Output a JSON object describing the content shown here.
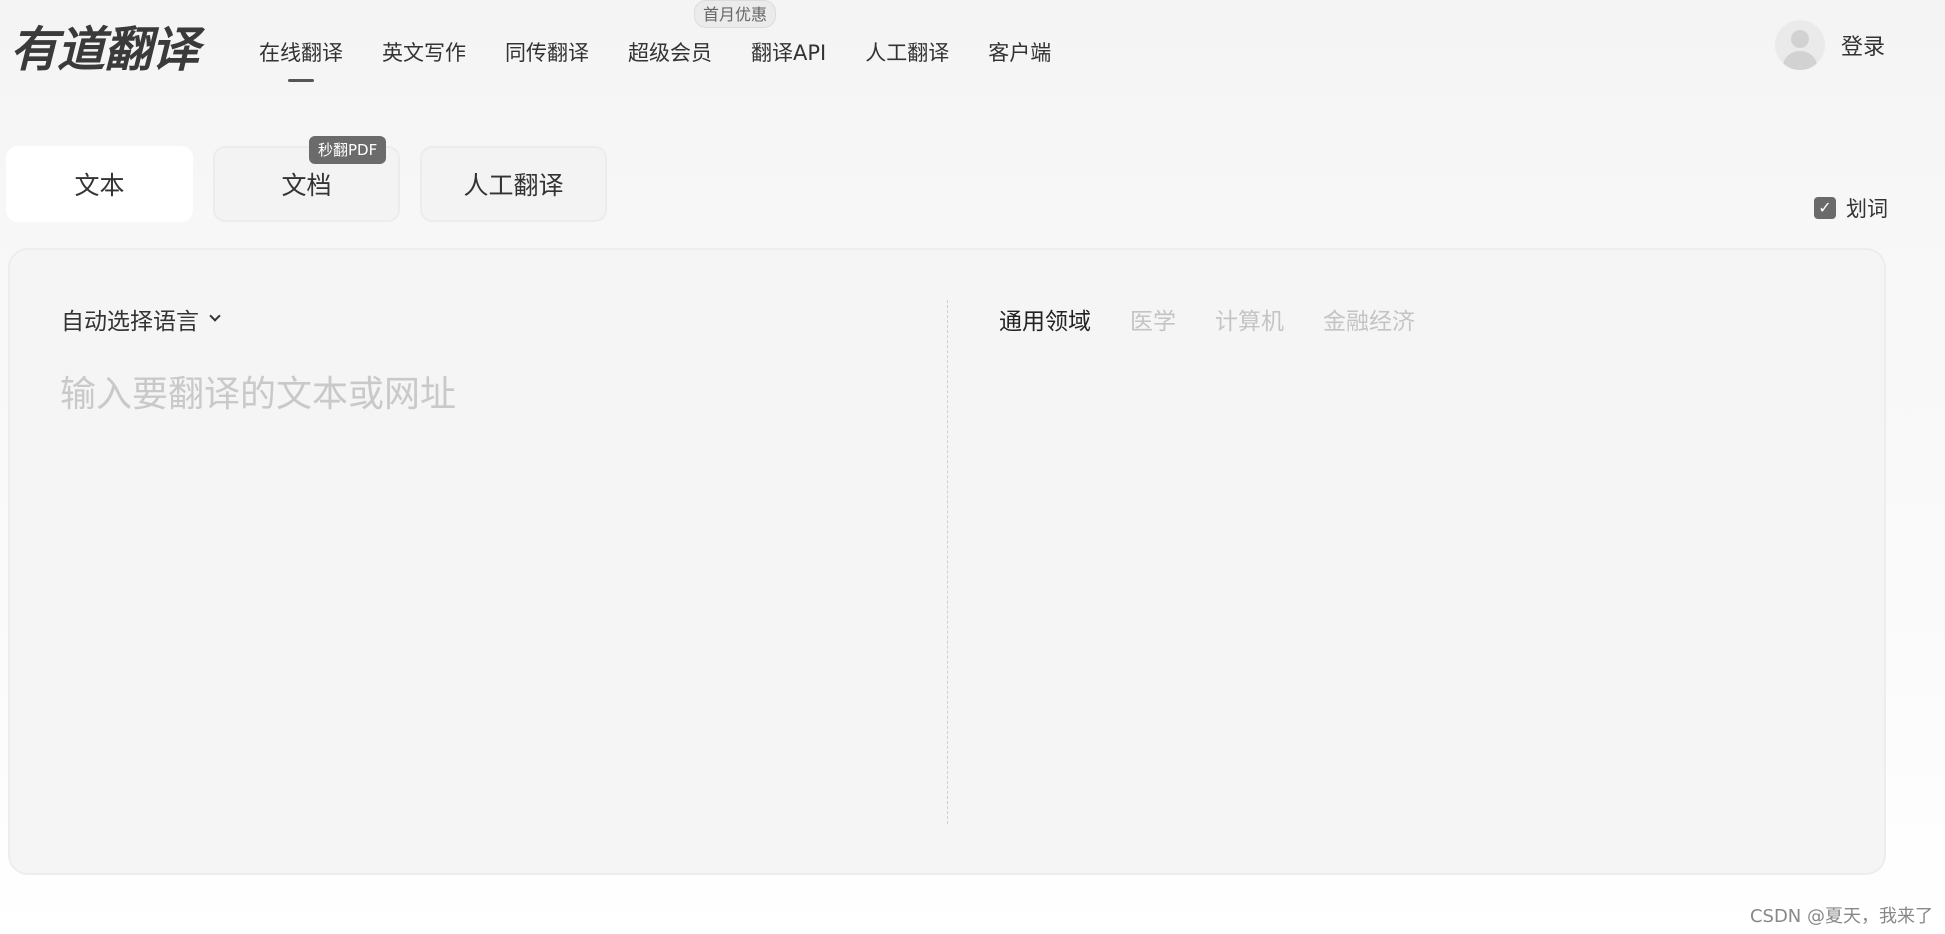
{
  "header": {
    "logo_text": "有道翻译",
    "promo_badge": "首月优惠",
    "nav": [
      {
        "label": "在线翻译",
        "active": true
      },
      {
        "label": "英文写作"
      },
      {
        "label": "同传翻译"
      },
      {
        "label": "超级会员"
      },
      {
        "label": "翻译API"
      },
      {
        "label": "人工翻译"
      },
      {
        "label": "客户端"
      }
    ],
    "login_label": "登录"
  },
  "mode_tabs": [
    {
      "label": "文本",
      "active": true
    },
    {
      "label": "文档",
      "badge": "秒翻PDF"
    },
    {
      "label": "人工翻译"
    }
  ],
  "huaci": {
    "label": "划词",
    "checked": true
  },
  "panel": {
    "language_select": "自动选择语言",
    "input_placeholder": "输入要翻译的文本或网址",
    "input_value": "",
    "domains": [
      {
        "label": "通用领域",
        "active": true
      },
      {
        "label": "医学"
      },
      {
        "label": "计算机"
      },
      {
        "label": "金融经济"
      }
    ]
  },
  "watermark": "CSDN @夏天，我来了",
  "colors": {
    "accent": "#333333",
    "muted": "#c4c4c4",
    "badge_bg": "#6b6b6b"
  }
}
